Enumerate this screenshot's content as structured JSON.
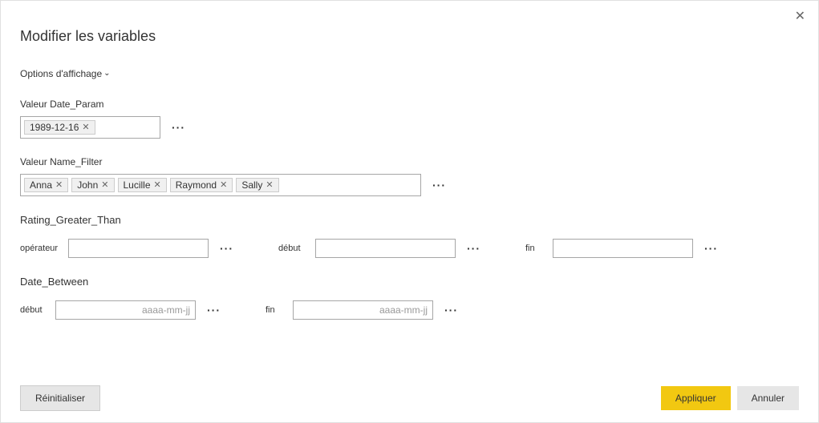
{
  "dialog": {
    "title": "Modifier les variables",
    "displayOptions": "Options d'affichage"
  },
  "dateParam": {
    "label": "Valeur Date_Param",
    "value": "1989-12-16"
  },
  "nameFilter": {
    "label": "Valeur Name_Filter",
    "tokens": [
      "Anna",
      "John",
      "Lucille",
      "Raymond",
      "Sally"
    ]
  },
  "ratingGreater": {
    "label": "Rating_Greater_Than",
    "operatorLabel": "opérateur",
    "startLabel": "début",
    "endLabel": "fin"
  },
  "dateBetween": {
    "label": "Date_Between",
    "startLabel": "début",
    "endLabel": "fin",
    "placeholder": "aaaa-mm-jj"
  },
  "buttons": {
    "reset": "Réinitialiser",
    "apply": "Appliquer",
    "cancel": "Annuler"
  }
}
